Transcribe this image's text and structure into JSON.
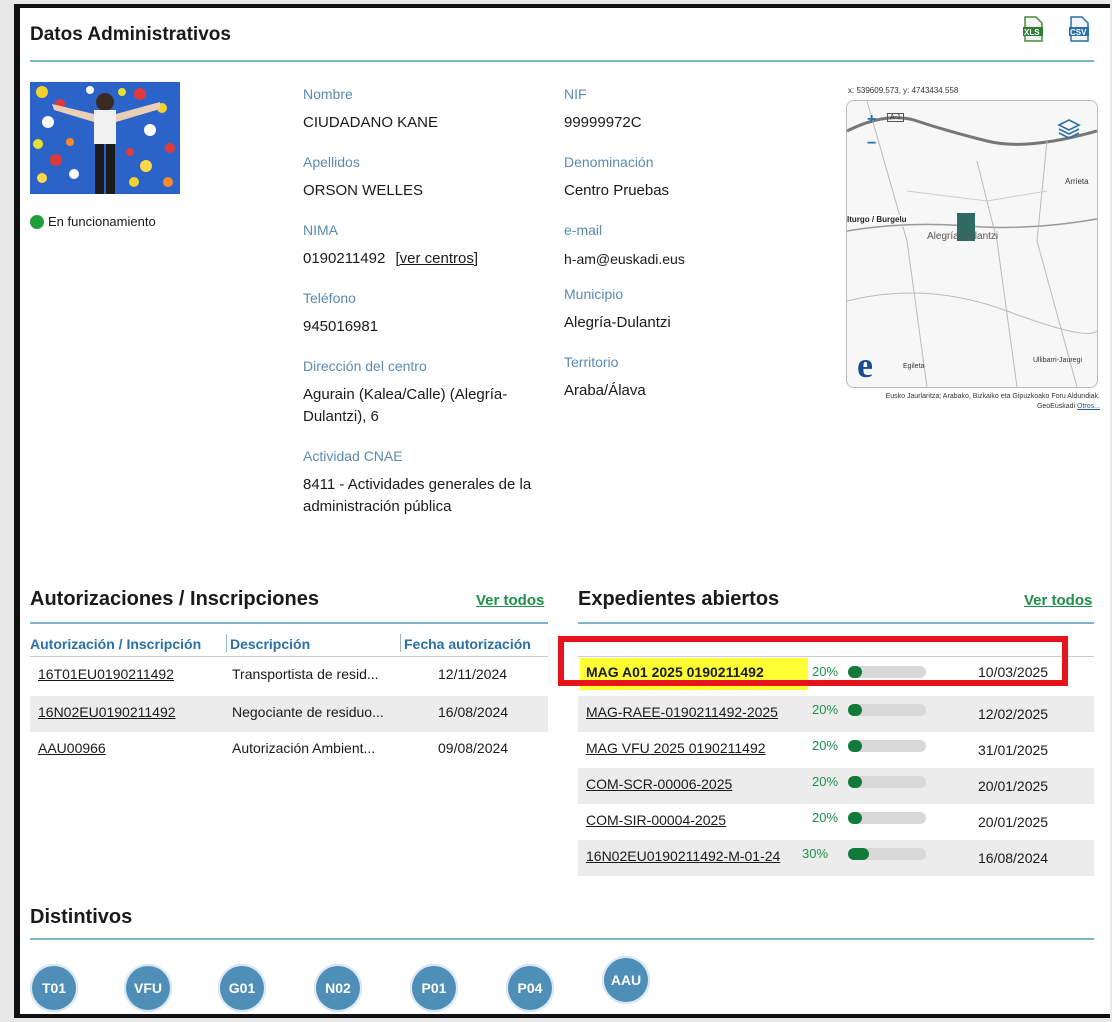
{
  "header": {
    "title": "Datos Administrativos",
    "xls_label": "XLS",
    "csv_label": "CSV"
  },
  "status": {
    "text": "En funcionamiento",
    "color": "#1f9e3a"
  },
  "fields": {
    "nombre_label": "Nombre",
    "nombre": "CIUDADANO KANE",
    "apellidos_label": "Apellidos",
    "apellidos": "ORSON WELLES",
    "nima_label": "NIMA",
    "nima": "0190211492",
    "ver_centros": "[ver centros]",
    "telefono_label": "Teléfono",
    "telefono": "945016981",
    "direccion_label": "Dirección del centro",
    "direccion": "Agurain (Kalea/Calle) (Alegría-Dulantzi), 6",
    "cnae_label": "Actividad CNAE",
    "cnae": "8411 - Actividades generales de la administración pública",
    "nif_label": "NIF",
    "nif": "99999972C",
    "denominacion_label": "Denominación",
    "denominacion": "Centro Pruebas",
    "email_label": "e-mail",
    "email": "h-am@euskadi.eus",
    "municipio_label": "Municipio",
    "municipio": "Alegría-Dulantzi",
    "territorio_label": "Territorio",
    "territorio": "Araba/Álava"
  },
  "map": {
    "coords": "x: 539609.573, y: 4743434.558",
    "place1": "Alegría-Dulantzi",
    "place2": "Iturgo / Burgelu",
    "place3": "Arrieta",
    "place4": "Egileta",
    "place5": "Ullibarri-Jauregi",
    "road": "A-1",
    "zoom_in": "+",
    "zoom_out": "−",
    "attribution": "Eusko Jaurlaritza; Arabako, Bizkaiko eta Gipuzkoako Foru Aldundiak. GeoEuskadi",
    "attribution_link": "Otros..."
  },
  "autorizaciones": {
    "title": "Autorizaciones / Inscripciones",
    "ver_todos": "Ver todos",
    "columns": [
      "Autorización / Inscripción",
      "Descripción",
      "Fecha autorización"
    ],
    "rows": [
      {
        "id": "16T01EU0190211492",
        "desc": "Transportista de resid...",
        "fecha": "12/11/2024"
      },
      {
        "id": "16N02EU0190211492",
        "desc": "Negociante de residuo...",
        "fecha": "16/08/2024"
      },
      {
        "id": "AAU00966",
        "desc": "Autorización Ambient...",
        "fecha": "09/08/2024"
      }
    ]
  },
  "expedientes": {
    "title": "Expedientes abiertos",
    "ver_todos": "Ver todos",
    "highlight_color": "#ffff33",
    "box_color": "#e8141b",
    "rows": [
      {
        "id": "MAG A01 2025 0190211492",
        "pct": "20%",
        "progress": 0.2,
        "fecha": "10/03/2025"
      },
      {
        "id": "MAG-RAEE-0190211492-2025",
        "pct": "20%",
        "progress": 0.2,
        "fecha": "12/02/2025"
      },
      {
        "id": "MAG VFU 2025 0190211492",
        "pct": "20%",
        "progress": 0.2,
        "fecha": "31/01/2025"
      },
      {
        "id": "COM-SCR-00006-2025",
        "pct": "20%",
        "progress": 0.2,
        "fecha": "20/01/2025"
      },
      {
        "id": "COM-SIR-00004-2025",
        "pct": "20%",
        "progress": 0.2,
        "fecha": "20/01/2025"
      },
      {
        "id": "16N02EU0190211492-M-01-24",
        "pct": "30%",
        "progress": 0.3,
        "fecha": "16/08/2024"
      }
    ]
  },
  "distintivos": {
    "title": "Distintivos",
    "badges": [
      "T01",
      "VFU",
      "G01",
      "N02",
      "P01",
      "P04",
      "AAU"
    ]
  }
}
